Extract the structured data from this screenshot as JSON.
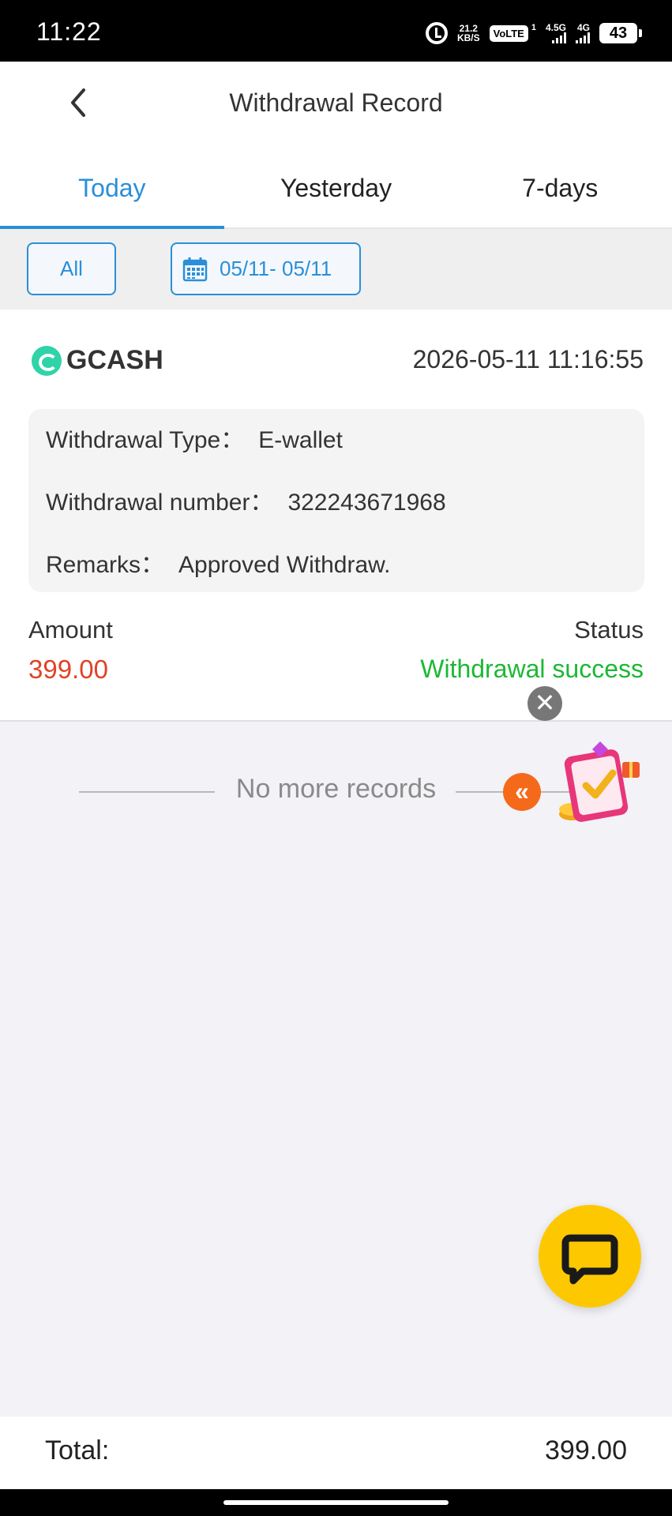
{
  "status_bar": {
    "time": "11:22",
    "speed_top": "21.2",
    "speed_unit": "KB/S",
    "volte": "VoLTE",
    "volte_sup": "1",
    "net1": "4.5G",
    "net2": "4G",
    "battery": "43"
  },
  "header": {
    "title": "Withdrawal Record",
    "back_icon": "chevron-left-icon"
  },
  "tabs": [
    {
      "label": "Today",
      "active": true
    },
    {
      "label": "Yesterday",
      "active": false
    },
    {
      "label": "7-days",
      "active": false
    }
  ],
  "filter": {
    "all_label": "All",
    "date_range": "05/11- 05/11",
    "date_icon": "calendar-icon"
  },
  "record": {
    "method": "GCASH",
    "datetime": "2026-05-11 11:16:55",
    "type_key": "Withdrawal Type：",
    "type_value": "E-wallet",
    "number_key": "Withdrawal number：",
    "number_value": "322243671968",
    "remarks_key": "Remarks：",
    "remarks_value": "Approved Withdraw.",
    "amount_label": "Amount",
    "amount_value": "399.00",
    "status_label": "Status",
    "status_value": "Withdrawal success",
    "colors": {
      "amount": "#e04226",
      "status": "#1cb834",
      "accent": "#2a8fd8"
    }
  },
  "list_footer": "No more records",
  "totals": {
    "label": "Total:",
    "value": "399.00"
  }
}
